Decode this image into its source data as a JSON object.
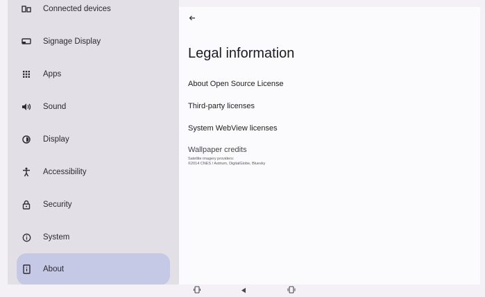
{
  "sidebar": {
    "items": [
      {
        "label": "Connected devices",
        "icon": "connected-devices-icon"
      },
      {
        "label": "Signage Display",
        "icon": "signage-display-icon"
      },
      {
        "label": "Apps",
        "icon": "apps-grid-icon"
      },
      {
        "label": "Sound",
        "icon": "speaker-icon"
      },
      {
        "label": "Display",
        "icon": "brightness-icon"
      },
      {
        "label": "Accessibility",
        "icon": "accessibility-icon"
      },
      {
        "label": "Security",
        "icon": "lock-icon"
      },
      {
        "label": "System",
        "icon": "info-circle-icon"
      },
      {
        "label": "About",
        "icon": "device-info-icon",
        "active": true
      }
    ]
  },
  "main": {
    "back_icon": "arrow-back-icon",
    "title": "Legal information",
    "rows": [
      {
        "label": "About Open Source License"
      },
      {
        "label": "Third-party licenses"
      },
      {
        "label": "System WebView licenses"
      }
    ],
    "wallpaper": {
      "title": "Wallpaper credits",
      "line1": "Satellite imagery providers:",
      "line2": "©2014 CNES / Astrium, DigitalGlobe, Bluesky"
    }
  },
  "navbar": {
    "buttons": [
      "rotate-icon",
      "back-triangle-icon",
      "screen-icon"
    ]
  },
  "colors": {
    "sidebar_bg": "#e2e0e6",
    "active_item_bg": "#c5c9e6",
    "main_bg": "#fbfbfd"
  }
}
